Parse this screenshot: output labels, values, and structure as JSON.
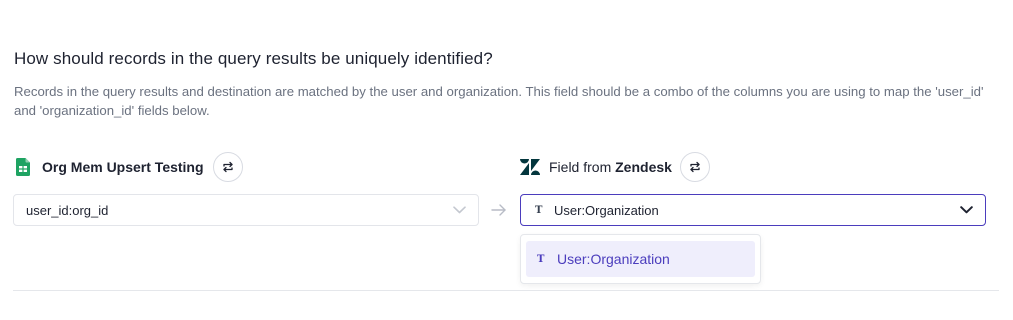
{
  "section": {
    "question": "How should records in the query results be uniquely identified?",
    "description": "Records in the query results and destination are matched by the user and organization. This field should be a combo of the columns you are using to map the 'user_id' and 'organization_id' fields below."
  },
  "source": {
    "name": "Org Mem Upsert Testing",
    "icon": "google-sheets-icon",
    "field_value": "user_id:org_id"
  },
  "destination": {
    "label_prefix": "Field from",
    "name": "Zendesk",
    "icon": "zendesk-icon",
    "field_type_icon": "T",
    "field_value": "User:Organization",
    "options": [
      {
        "type_icon": "T",
        "label": "User:Organization"
      }
    ]
  },
  "colors": {
    "accent": "#4b3dbd",
    "option_highlight": "#efeefc",
    "sheets_green": "#1ea362"
  }
}
